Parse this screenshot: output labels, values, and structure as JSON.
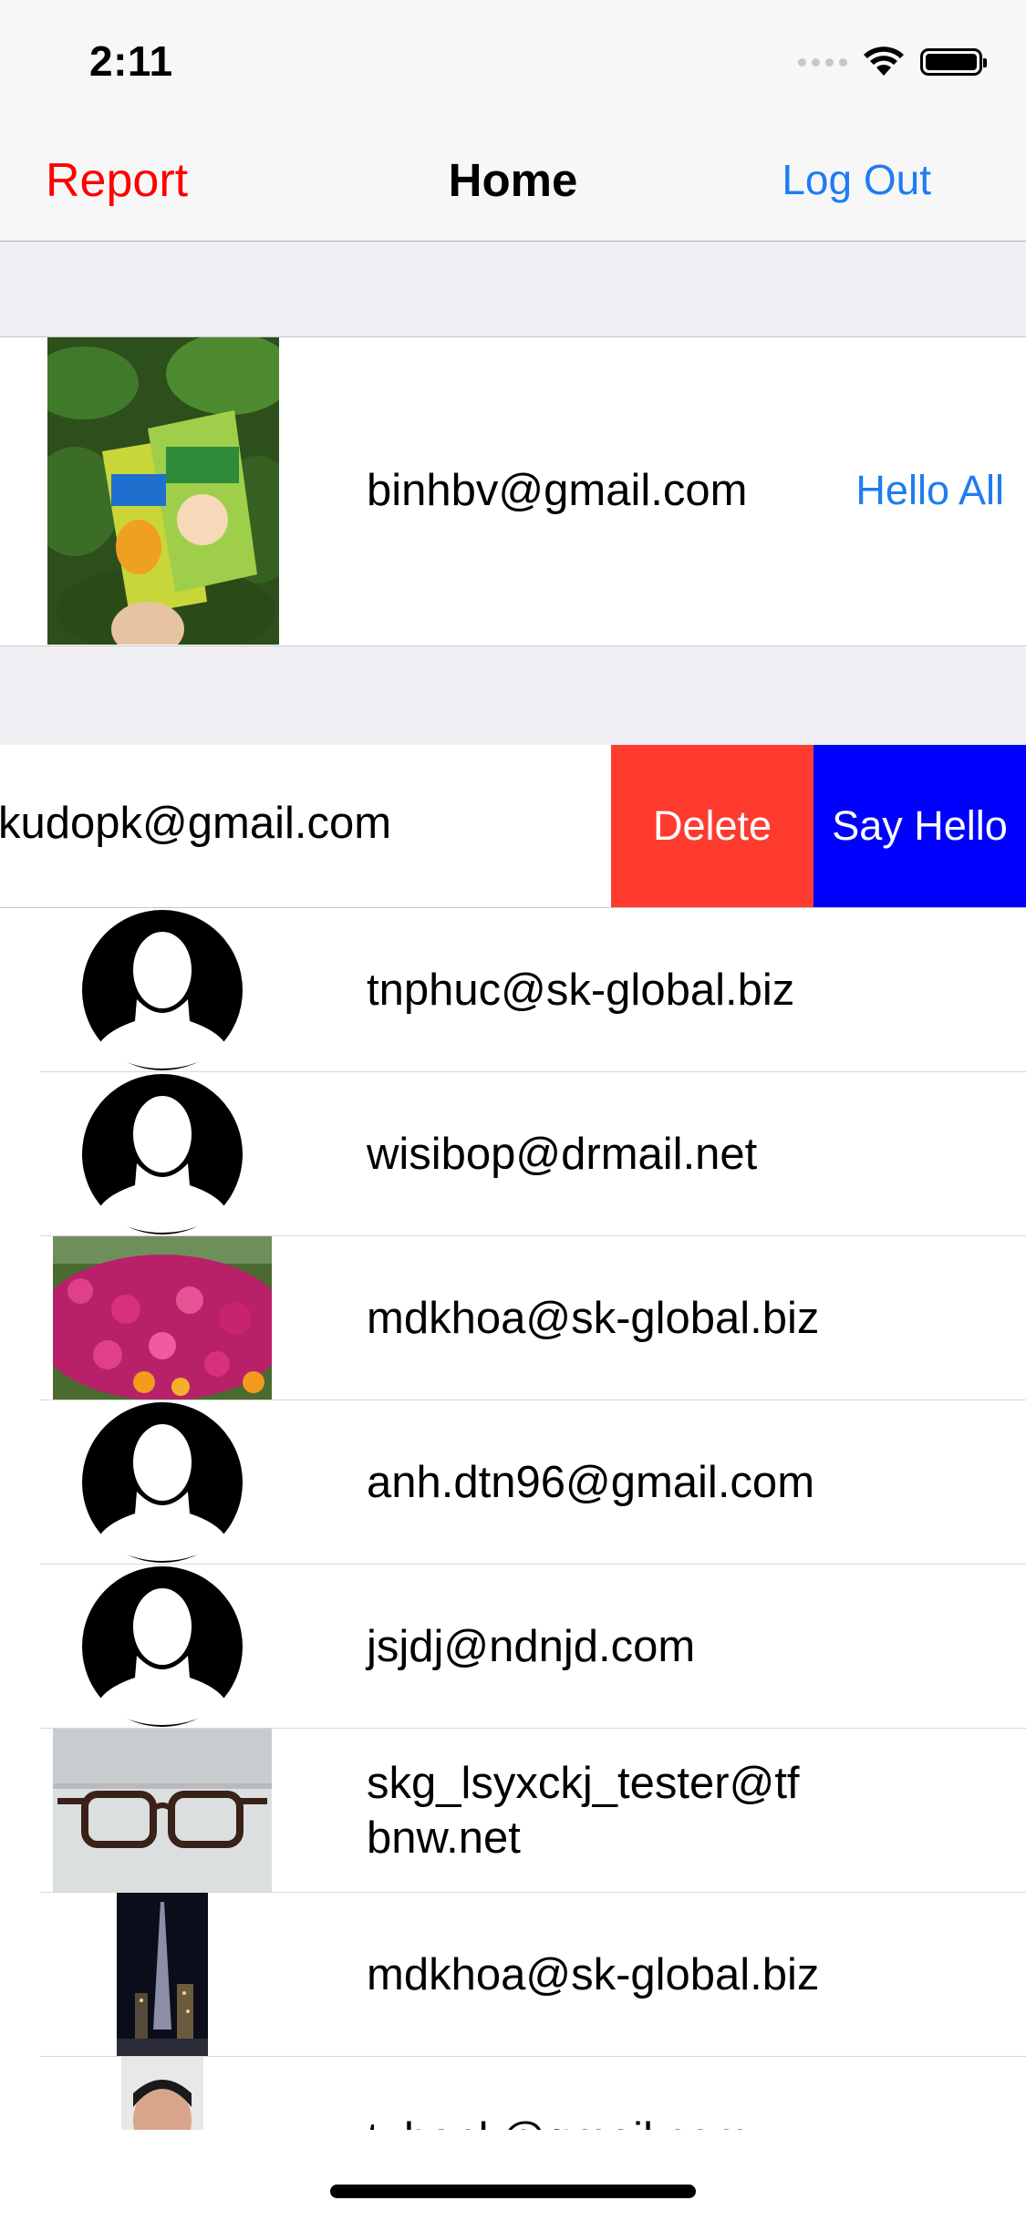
{
  "status_bar": {
    "time": "2:11"
  },
  "nav": {
    "left": "Report",
    "title": "Home",
    "right": "Log Out"
  },
  "current_user": {
    "email": "binhbv@gmail.com",
    "action": "Hello All"
  },
  "swiped_row": {
    "email": "kudopk@gmail.com",
    "delete": "Delete",
    "say_hello": "Say Hello"
  },
  "users": [
    {
      "email": "tnphuc@sk-global.biz",
      "avatar": "default-avatar-icon"
    },
    {
      "email": "wisibop@drmail.net",
      "avatar": "default-avatar-icon"
    },
    {
      "email": "mdkhoa@sk-global.biz",
      "avatar": "photo-flowers"
    },
    {
      "email": "anh.dtn96@gmail.com",
      "avatar": "default-avatar-icon"
    },
    {
      "email": "jsjdj@ndnjd.com",
      "avatar": "default-avatar-icon"
    },
    {
      "email": "skg_lsyxckj_tester@tfbnw.net",
      "avatar": "photo-glasses"
    },
    {
      "email": "mdkhoa@sk-global.biz",
      "avatar": "photo-city-night"
    },
    {
      "email": "tuhank@gmail.com",
      "avatar": "photo-person"
    }
  ]
}
